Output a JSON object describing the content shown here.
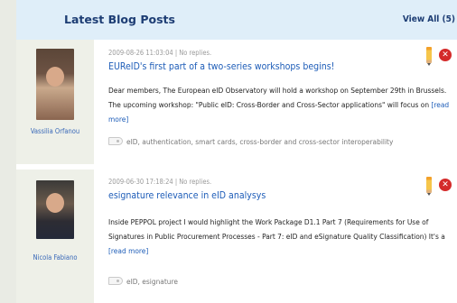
{
  "header": {
    "title": "Latest Blog Posts",
    "view_all_label": "View All (5)"
  },
  "posts": [
    {
      "author": "Vassilia Orfanou",
      "timestamp": "2009-08-26 11:03:04",
      "replies": "| No replies.",
      "title": "EUReID's first part of a two-series workshops begins!",
      "excerpt": "Dear members, The European eID Observatory will hold a workshop on September 29th in Brussels. The upcoming workshop: \"Public eID: Cross-Border and Cross-Sector applications\" will focus on",
      "read_more": "[read more]",
      "tags": "eID, authentication, smart cards, cross-border and cross-sector interoperability"
    },
    {
      "author": "Nicola Fabiano",
      "timestamp": "2009-06-30 17:18:24",
      "replies": "| No replies.",
      "title": "esignature relevance in eID analysys",
      "excerpt": "Inside PEPPOL project I would highlight the Work Package D1.1 Part 7 (Requirements for Use of Signatures in Public Procurement Processes - Part 7: eID and eSignature Quality Classification) It's a",
      "read_more": "[read more]",
      "tags": "eID, esignature"
    }
  ],
  "icons": {
    "edit": "pencil-icon",
    "delete": "delete-icon",
    "delete_glyph": "✕",
    "tag": "tag-icon"
  },
  "colors": {
    "header_bg": "#dfeef9",
    "header_text": "#1d3d74",
    "link": "#1e5db8",
    "delete": "#d42a2a"
  }
}
